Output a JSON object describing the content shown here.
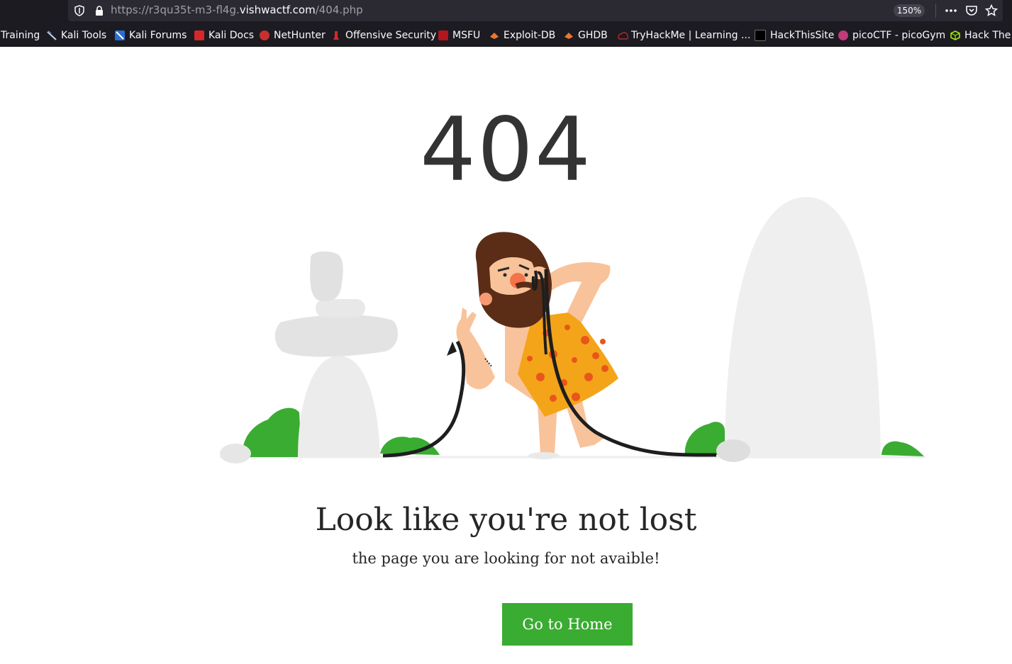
{
  "browser": {
    "url_prefix": "https://r3qu35t-m3-fl4g.",
    "url_domain": "vishwactf.com",
    "url_path": "/404.php",
    "zoom": "150%",
    "bookmarks": [
      {
        "label": "Training",
        "icon": "none"
      },
      {
        "label": "Kali Tools",
        "icon": "kali-dragon-icon"
      },
      {
        "label": "Kali Forums",
        "icon": "kali-forums-icon"
      },
      {
        "label": "Kali Docs",
        "icon": "kali-docs-icon"
      },
      {
        "label": "NetHunter",
        "icon": "nethunter-icon"
      },
      {
        "label": "Offensive Security",
        "icon": "offsec-icon"
      },
      {
        "label": "MSFU",
        "icon": "msfu-icon"
      },
      {
        "label": "Exploit-DB",
        "icon": "exploit-db-icon"
      },
      {
        "label": "GHDB",
        "icon": "ghdb-icon"
      },
      {
        "label": "TryHackMe | Learning ...",
        "icon": "tryhackme-icon"
      },
      {
        "label": "HackThisSite",
        "icon": "hackthissite-icon"
      },
      {
        "label": "picoCTF - picoGym",
        "icon": "picoctf-icon"
      },
      {
        "label": "Hack The",
        "icon": "hackthebox-icon"
      }
    ]
  },
  "page": {
    "code": "404",
    "headline": "Look like you're not lost",
    "subline": "the page you are looking for not avaible!",
    "button_label": "Go to Home"
  },
  "colors": {
    "accent_green": "#39ac31",
    "text_dark": "#333333",
    "rock_gray": "#e8e8e8"
  }
}
